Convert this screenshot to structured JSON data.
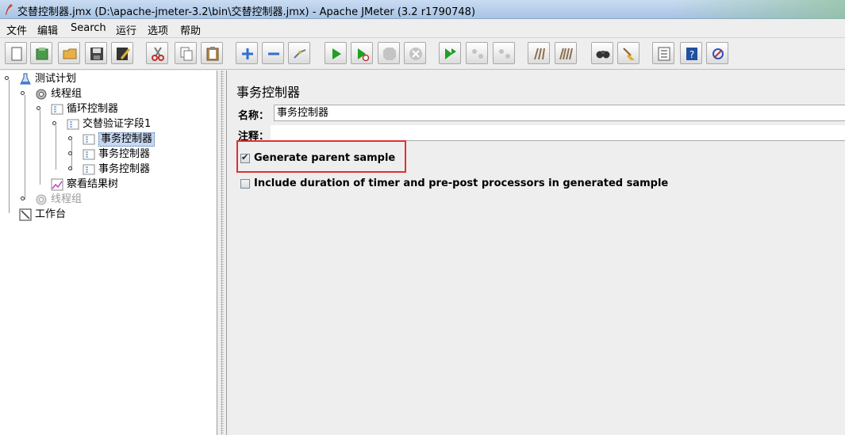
{
  "window": {
    "title": "交替控制器.jmx (D:\\apache-jmeter-3.2\\bin\\交替控制器.jmx) - Apache JMeter (3.2 r1790748)"
  },
  "menu": [
    "文件",
    "编辑",
    "Search",
    "运行",
    "选项",
    "帮助"
  ],
  "toolbar": [
    {
      "name": "new-icon",
      "color": "#ffffff"
    },
    {
      "name": "templates-icon",
      "color": "#3a8a3a"
    },
    {
      "name": "open-icon",
      "color": "#e2a63b"
    },
    {
      "name": "save-icon",
      "color": "#333333"
    },
    {
      "name": "save-as-icon",
      "color": "#444444"
    },
    {
      "name": "cut-icon",
      "color": "#c03030"
    },
    {
      "name": "copy-icon",
      "color": "#888888"
    },
    {
      "name": "paste-icon",
      "color": "#a07840"
    },
    {
      "name": "expand-icon",
      "color": "#2f6fd0"
    },
    {
      "name": "collapse-icon",
      "color": "#2f6fd0"
    },
    {
      "name": "toggle-icon",
      "color": "#5a7a9a"
    },
    {
      "name": "start-icon",
      "color": "#1fa01f"
    },
    {
      "name": "start-no-pauses-icon",
      "color": "#1fa01f"
    },
    {
      "name": "stop-icon",
      "color": "#b8b8b8"
    },
    {
      "name": "shutdown-icon",
      "color": "#b8b8b8"
    },
    {
      "name": "remote-start-icon",
      "color": "#1fa01f"
    },
    {
      "name": "remote-stop-icon",
      "color": "#b8b8b8"
    },
    {
      "name": "remote-shutdown-icon",
      "color": "#b8b8b8"
    },
    {
      "name": "clear-icon",
      "color": "#8a7050"
    },
    {
      "name": "clear-all-icon",
      "color": "#8a7050"
    },
    {
      "name": "search-icon",
      "color": "#333333"
    },
    {
      "name": "reset-search-icon",
      "color": "#e0b030"
    },
    {
      "name": "function-helper-icon",
      "color": "#333333"
    },
    {
      "name": "help-icon",
      "color": "#2050a0"
    },
    {
      "name": "log-viewer-icon",
      "color": "#3050c0"
    }
  ],
  "tree": [
    {
      "label": "测试计划",
      "icon": "test-plan-icon"
    },
    {
      "label": "线程组",
      "icon": "gear-icon"
    },
    {
      "label": "循环控制器",
      "icon": "controller-icon"
    },
    {
      "label": "交替验证字段1",
      "icon": "controller-icon"
    },
    {
      "label": "事务控制器",
      "icon": "controller-icon"
    },
    {
      "label": "事务控制器",
      "icon": "controller-icon"
    },
    {
      "label": "事务控制器",
      "icon": "controller-icon"
    },
    {
      "label": "察看结果树",
      "icon": "chart-icon"
    },
    {
      "label": "线程组",
      "icon": "gear-icon"
    },
    {
      "label": "工作台",
      "icon": "workbench-icon"
    }
  ],
  "panel": {
    "title": "事务控制器",
    "name_label": "名称：",
    "name_value": "事务控制器",
    "comment_label": "注释：",
    "comment_value": "",
    "generate_parent_label": "Generate parent sample",
    "generate_parent_checked": true,
    "include_duration_label": "Include duration of timer and pre-post processors in generated sample",
    "include_duration_checked": false
  },
  "colors": {
    "highlight": "#e03030",
    "selection": "#c7d9f0"
  }
}
